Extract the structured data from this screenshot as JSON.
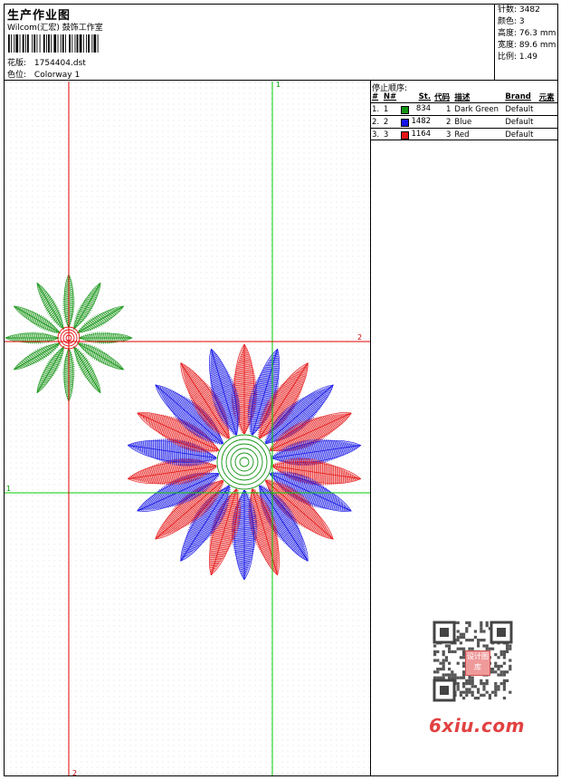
{
  "header": {
    "title": "生产作业图",
    "company": "Wilcom(汇宏) 鼓饰工作室",
    "design_file_label": "花版:",
    "design_file": "1754404.dst",
    "colorway_label": "色位:",
    "colorway": "Colorway 1"
  },
  "stats": {
    "stitches_label": "针数:",
    "stitches": "3482",
    "colors_label": "颜色:",
    "colors": "3",
    "height_label": "高度:",
    "height": "76.3 mm",
    "width_label": "宽度:",
    "width": "89.6 mm",
    "scale_label": "比例:",
    "scale": "1.49"
  },
  "stop_sequence": {
    "title": "停止顺序:",
    "columns": [
      "#",
      "N#",
      "St.",
      "代码",
      "描述",
      "Brand",
      "元素"
    ],
    "rows": [
      {
        "num": "1.",
        "n": "1",
        "color": "#149414",
        "stitches": "834",
        "code": "1",
        "desc": "Dark Green",
        "brand": "Default"
      },
      {
        "num": "2.",
        "n": "2",
        "color": "#1414e6",
        "stitches": "1482",
        "code": "2",
        "desc": "Blue",
        "brand": "Default"
      },
      {
        "num": "3.",
        "n": "3",
        "color": "#e61414",
        "stitches": "1164",
        "code": "3",
        "desc": "Red",
        "brand": "Default"
      }
    ]
  },
  "guides": {
    "green_v_label": "1",
    "green_h_label": "1",
    "red_h_label": "2",
    "red_v_label": "2"
  },
  "watermark": {
    "site": "6xiu.com",
    "seal": "设计图库"
  },
  "colors": {
    "green": "#149414",
    "blue": "#1414e6",
    "red": "#e61414",
    "guide_green": "#00cc00",
    "guide_red": "#e00000"
  }
}
